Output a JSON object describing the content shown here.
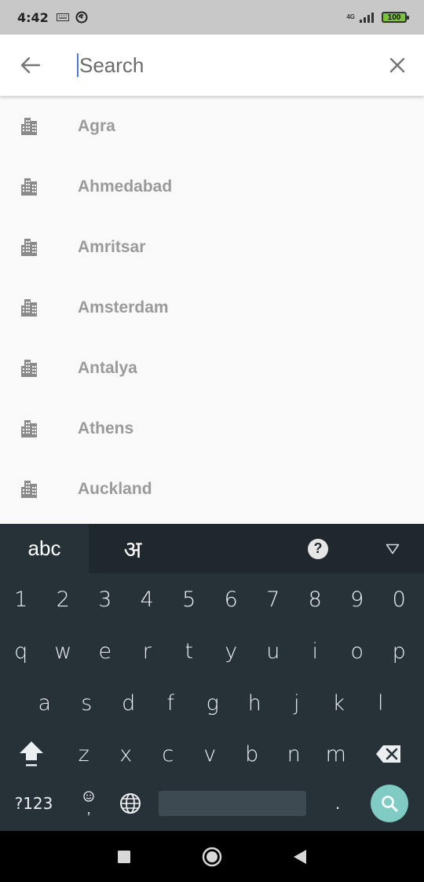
{
  "status_bar": {
    "time": "4:42",
    "network": "4G",
    "battery": "100"
  },
  "search": {
    "placeholder": "Search",
    "value": ""
  },
  "results": [
    {
      "label": "Agra",
      "icon": "city-icon"
    },
    {
      "label": "Ahmedabad",
      "icon": "city-icon"
    },
    {
      "label": "Amritsar",
      "icon": "city-icon"
    },
    {
      "label": "Amsterdam",
      "icon": "city-icon"
    },
    {
      "label": "Antalya",
      "icon": "city-icon"
    },
    {
      "label": "Athens",
      "icon": "city-icon"
    },
    {
      "label": "Auckland",
      "icon": "city-icon"
    }
  ],
  "keyboard": {
    "tab_abc": "abc",
    "tab_hindi": "अ",
    "help": "?",
    "row_numbers": [
      "1",
      "2",
      "3",
      "4",
      "5",
      "6",
      "7",
      "8",
      "9",
      "0"
    ],
    "row_q": [
      "q",
      "w",
      "e",
      "r",
      "t",
      "y",
      "u",
      "i",
      "o",
      "p"
    ],
    "row_a": [
      "a",
      "s",
      "d",
      "f",
      "g",
      "h",
      "j",
      "k",
      "l"
    ],
    "row_z": [
      "z",
      "x",
      "c",
      "v",
      "b",
      "n",
      "m"
    ],
    "sym_label": "?123",
    "emoji_comma": ",",
    "period": "."
  },
  "colors": {
    "accent_cursor": "#4a7bd6",
    "keyboard_bg": "#263238",
    "search_key": "#80cbc4",
    "battery": "#7cc242"
  }
}
